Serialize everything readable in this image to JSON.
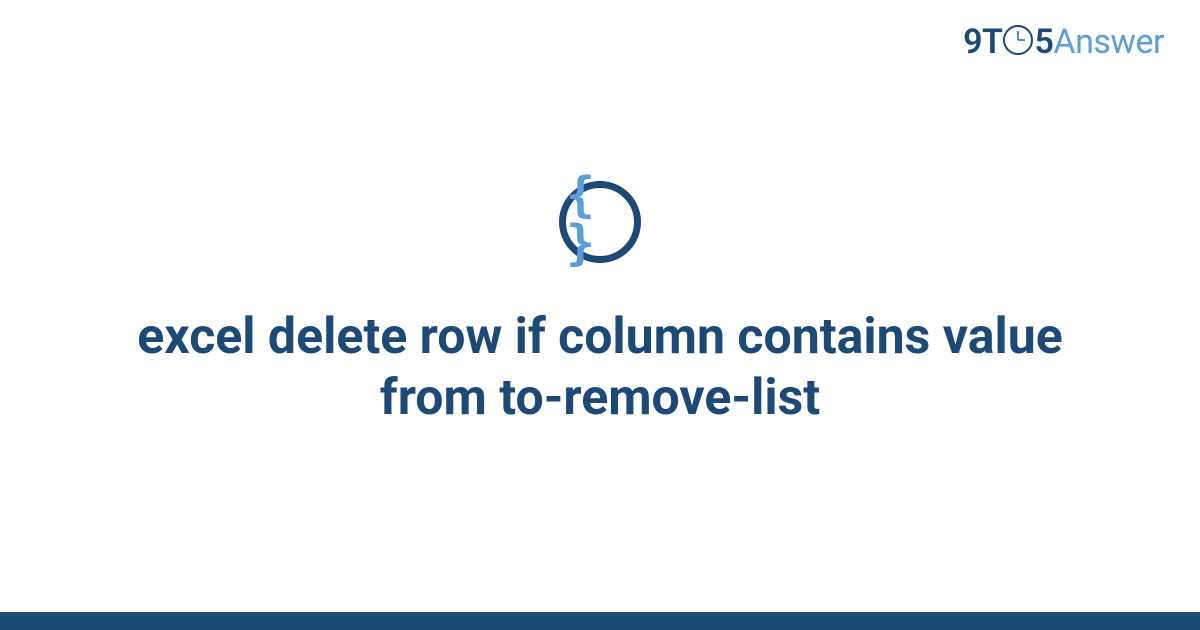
{
  "brand": {
    "part1": "9T",
    "part2": "5",
    "part3": "Answer"
  },
  "icon": {
    "braces": "{ }"
  },
  "main": {
    "title": "excel delete row if column contains value from to-remove-list"
  }
}
